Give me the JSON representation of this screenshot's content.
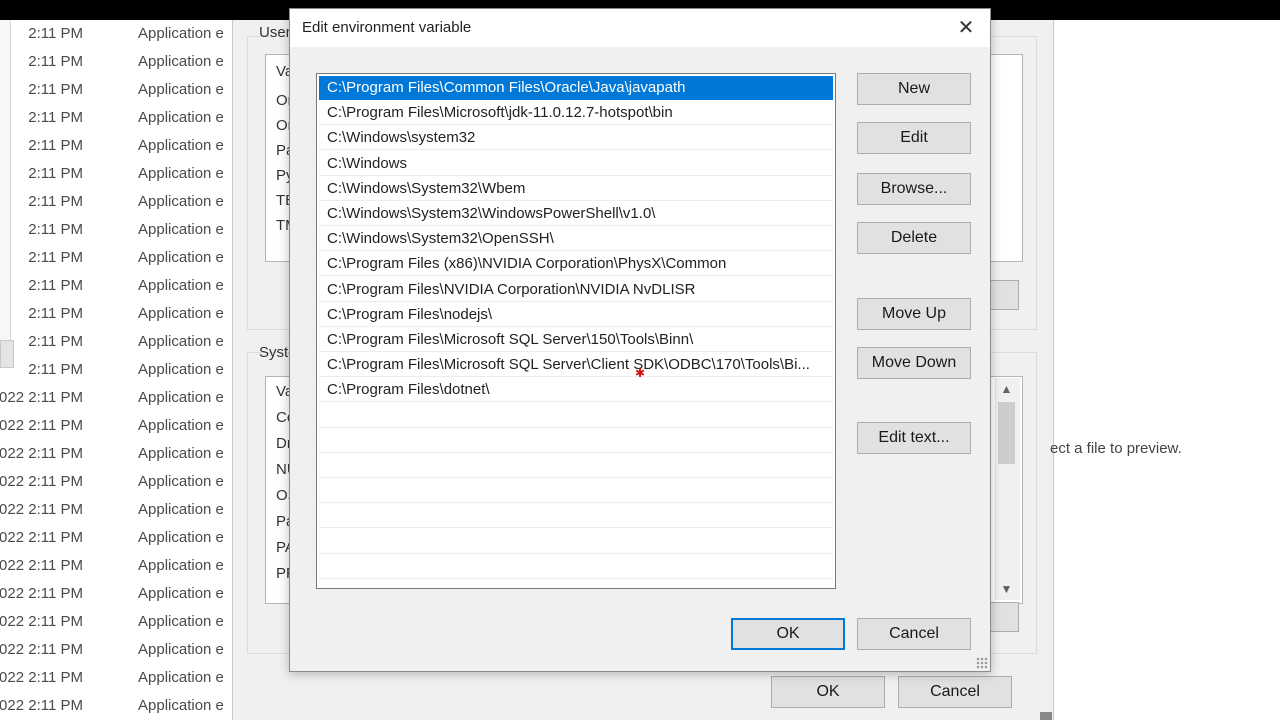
{
  "explorer": {
    "rows": [
      {
        "date": "2:11 PM",
        "type": "Application e"
      },
      {
        "date": "2:11 PM",
        "type": "Application e"
      },
      {
        "date": "2:11 PM",
        "type": "Application e"
      },
      {
        "date": "2:11 PM",
        "type": "Application e"
      },
      {
        "date": "2:11 PM",
        "type": "Application e"
      },
      {
        "date": "2:11 PM",
        "type": "Application e"
      },
      {
        "date": "2:11 PM",
        "type": "Application e"
      },
      {
        "date": "2:11 PM",
        "type": "Application e"
      },
      {
        "date": "2:11 PM",
        "type": "Application e"
      },
      {
        "date": "2:11 PM",
        "type": "Application e"
      },
      {
        "date": "2:11 PM",
        "type": "Application e"
      },
      {
        "date": "2:11 PM",
        "type": "Application e"
      },
      {
        "date": "2:11 PM",
        "type": "Application e"
      },
      {
        "date": "022 2:11 PM",
        "type": "Application e"
      },
      {
        "date": "022 2:11 PM",
        "type": "Application e"
      },
      {
        "date": "022 2:11 PM",
        "type": "Application e"
      },
      {
        "date": "022 2:11 PM",
        "type": "Application e"
      },
      {
        "date": "022 2:11 PM",
        "type": "Application e"
      },
      {
        "date": "022 2:11 PM",
        "type": "Application e"
      },
      {
        "date": "022 2:11 PM",
        "type": "Application e"
      },
      {
        "date": "022 2:11 PM",
        "type": "Application e"
      },
      {
        "date": "022 2:11 PM",
        "type": "Application e"
      },
      {
        "date": "022 2:11 PM",
        "type": "Application e"
      },
      {
        "date": "022 2:11 PM",
        "type": "Application e"
      },
      {
        "date": "022 2:11 PM",
        "type": "Application e"
      },
      {
        "date": "022 2:11 PM",
        "type": "Application e"
      }
    ]
  },
  "env_dialog": {
    "user_group_label": "User",
    "system_group_label": "Syste",
    "user_list": [
      "Va",
      "Or",
      "Or",
      "Pa",
      "Py",
      "TE",
      "TM"
    ],
    "system_list": [
      "Va",
      "Co",
      "Dr",
      "NU",
      "OS",
      "Pa",
      "PA",
      "PF"
    ],
    "ok_label": "OK",
    "cancel_label": "Cancel"
  },
  "preview_text": "ect a file to preview.",
  "edit_dialog": {
    "title": "Edit environment variable",
    "close_symbol": "✕",
    "paths": [
      "C:\\Program Files\\Common Files\\Oracle\\Java\\javapath",
      "C:\\Program Files\\Microsoft\\jdk-11.0.12.7-hotspot\\bin",
      "C:\\Windows\\system32",
      "C:\\Windows",
      "C:\\Windows\\System32\\Wbem",
      "C:\\Windows\\System32\\WindowsPowerShell\\v1.0\\",
      "C:\\Windows\\System32\\OpenSSH\\",
      "C:\\Program Files (x86)\\NVIDIA Corporation\\PhysX\\Common",
      "C:\\Program Files\\NVIDIA Corporation\\NVIDIA NvDLISR",
      "C:\\Program Files\\nodejs\\",
      "C:\\Program Files\\Microsoft SQL Server\\150\\Tools\\Binn\\",
      "C:\\Program Files\\Microsoft SQL Server\\Client SDK\\ODBC\\170\\Tools\\Bi...",
      "C:\\Program Files\\dotnet\\"
    ],
    "buttons": {
      "new": "New",
      "edit": "Edit",
      "browse": "Browse...",
      "delete": "Delete",
      "move_up": "Move Up",
      "move_down": "Move Down",
      "edit_text": "Edit text...",
      "ok": "OK",
      "cancel": "Cancel"
    }
  },
  "colors": {
    "selection": "#0078d7",
    "dialog_bg": "#f0f0f0"
  }
}
